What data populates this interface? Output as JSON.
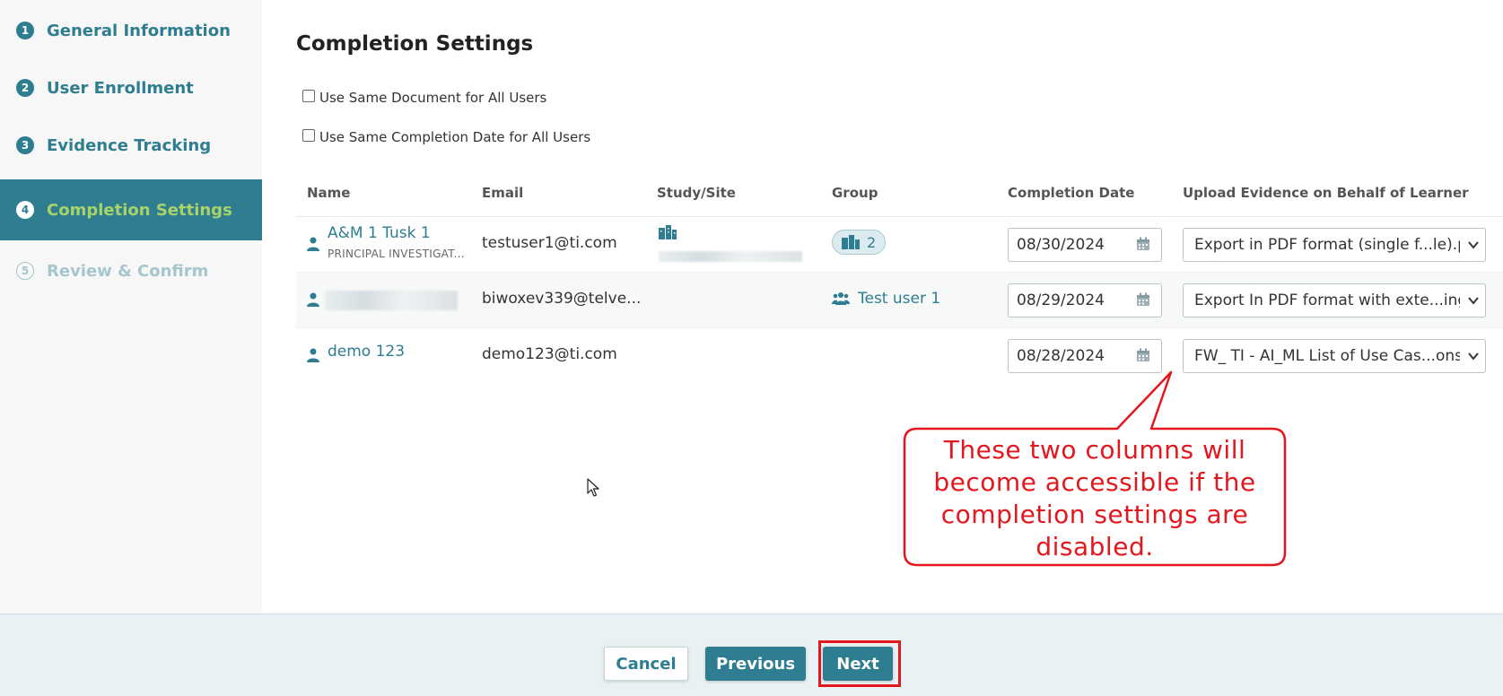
{
  "steps": [
    {
      "number": "1",
      "label": "General Information",
      "state": "done"
    },
    {
      "number": "2",
      "label": "User Enrollment",
      "state": "done"
    },
    {
      "number": "3",
      "label": "Evidence Tracking",
      "state": "done"
    },
    {
      "number": "4",
      "label": "Completion Settings",
      "state": "active"
    },
    {
      "number": "5",
      "label": "Review & Confirm",
      "state": "disabled"
    }
  ],
  "main": {
    "title": "Completion Settings",
    "checkboxes": [
      {
        "label": "Use Same Document for All Users",
        "checked": false
      },
      {
        "label": "Use Same Completion Date for All Users",
        "checked": false
      }
    ]
  },
  "table": {
    "headers": [
      "Name",
      "Email",
      "Study/Site",
      "Group",
      "Completion Date",
      "Upload Evidence on Behalf of Learner"
    ],
    "rows": [
      {
        "name": "A&M 1 Tusk 1",
        "role": "PRINCIPAL INVESTIGAT...",
        "email": "testuser1@ti.com",
        "study_site_icon": "building-icon",
        "group": "2",
        "group_type": "badge",
        "completion_date": "08/30/2024",
        "evidence": "Export in PDF format (single f...le).pd"
      },
      {
        "name": "",
        "role": "",
        "email": "biwoxev339@telve...",
        "group": "Test user 1",
        "group_type": "link",
        "completion_date": "08/29/2024",
        "evidence": "Export In PDF format with exte...ing.p"
      },
      {
        "name": "demo 123",
        "role": "",
        "email": "demo123@ti.com",
        "group": "",
        "group_type": "none",
        "completion_date": "08/28/2024",
        "evidence": "FW_ TI - AI_ML List of Use Cas...ons.p"
      }
    ]
  },
  "callout": {
    "lines": [
      "These two columns will",
      "become accessible if the",
      "completion settings are",
      "disabled."
    ]
  },
  "footer": {
    "cancel_label": "Cancel",
    "previous_label": "Previous",
    "next_label": "Next"
  },
  "colors": {
    "accent": "#2e7d90",
    "active_label": "#a8d36b",
    "callout_red": "#e3171d"
  }
}
